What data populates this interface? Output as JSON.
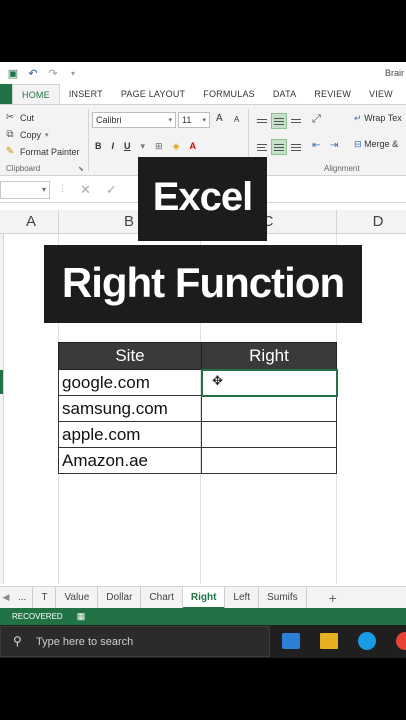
{
  "app": {
    "title": "Brair"
  },
  "ribbon": {
    "tabs": [
      "HOME",
      "INSERT",
      "PAGE LAYOUT",
      "FORMULAS",
      "DATA",
      "REVIEW",
      "VIEW"
    ],
    "clipboard": {
      "cut": "Cut",
      "copy": "Copy",
      "format_painter": "Format Painter",
      "group_label": "Clipboard"
    },
    "font": {
      "name": "Calibri",
      "size": "11",
      "bold": "B",
      "italic": "I",
      "underline": "U",
      "grow": "A",
      "shrink": "A"
    },
    "alignment": {
      "wrap_text": "Wrap Tex",
      "merge": "Merge &",
      "group_label": "Alignment"
    }
  },
  "formula_bar": {
    "cancel": "✕",
    "enter": "✓"
  },
  "columns": [
    "A",
    "B",
    "C",
    "D"
  ],
  "overlay": {
    "line1": "Excel",
    "line2": "Right Function"
  },
  "table": {
    "headers": [
      "Site",
      "Right"
    ],
    "rows": [
      [
        "google.com",
        ""
      ],
      [
        "samsung.com",
        ""
      ],
      [
        "apple.com",
        ""
      ],
      [
        "Amazon.ae",
        ""
      ]
    ]
  },
  "sheet_tabs": {
    "ellipsis": "...",
    "tabs": [
      "T",
      "Value",
      "Dollar",
      "Chart",
      "Right",
      "Left",
      "Sumifs"
    ],
    "active": "Right",
    "add": "+"
  },
  "status_bar": {
    "text": "RECOVERED"
  },
  "taskbar": {
    "search_placeholder": "Type here to search"
  },
  "colors": {
    "excel_green": "#217346",
    "header_fill": "#3a3a3a",
    "overlay_bg": "#1c1c1c"
  }
}
